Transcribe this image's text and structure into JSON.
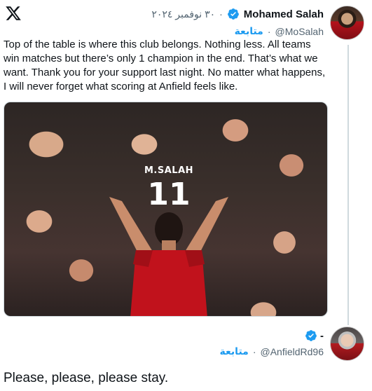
{
  "tweet": {
    "author_name": "Mohamed Salah",
    "date": "٣٠ نوفمبر ٢٠٢٤",
    "separator": "·",
    "handle": "@MoSalah",
    "follow_label": "متابعة",
    "text": "Top of the table is where this club belongs. Nothing less. All teams win matches but there’s only 1 champion in the end. That’s what we want. Thank you for your support last night. No matter what happens, I will never forget what scoring at Anfield feels like.",
    "photo": {
      "shirt_name": "M.SALAH",
      "shirt_number": "11"
    }
  },
  "reply": {
    "author_name": "-",
    "handle": "@AnfieldRd96",
    "separator": "·",
    "follow_label": "متابعة",
    "text": "Please, please, please stay."
  },
  "icons": {
    "logo": "x-logo-icon",
    "verified": "verified-badge-icon"
  },
  "colors": {
    "accent": "#1d9bf0",
    "secondary_text": "#536471",
    "primary_text": "#0f1419"
  }
}
